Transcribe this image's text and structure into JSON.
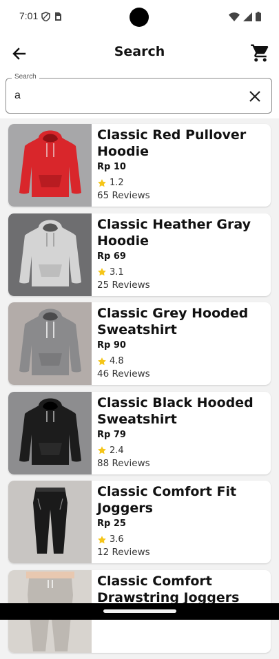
{
  "status": {
    "time": "7:01",
    "icons": [
      "shield-icon",
      "sim-card-icon",
      "wifi-icon",
      "signal-icon",
      "battery-icon"
    ]
  },
  "app_bar": {
    "title": "Search",
    "back_icon": "arrow-back-icon",
    "cart_icon": "shopping-cart-icon"
  },
  "search": {
    "label": "Search",
    "value": "a",
    "clear_icon": "close-icon"
  },
  "products": [
    {
      "name": "Classic Red Pullover Hoodie",
      "price": "Rp 10",
      "rating": "1.2",
      "reviews": "65 Reviews",
      "image": "red-hoodie",
      "color": "#d9262b"
    },
    {
      "name": "Classic Heather Gray Hoodie",
      "price": "Rp 69",
      "rating": "3.1",
      "reviews": "25 Reviews",
      "image": "heather-gray-hoodie",
      "color": "#c9c9c9"
    },
    {
      "name": "Classic Grey Hooded Sweatshirt",
      "price": "Rp 90",
      "rating": "4.8",
      "reviews": "46 Reviews",
      "image": "grey-hooded-sweatshirt",
      "color": "#8a8a8c"
    },
    {
      "name": "Classic Black Hooded Sweatshirt",
      "price": "Rp 79",
      "rating": "2.4",
      "reviews": "88 Reviews",
      "image": "black-hooded-sweatshirt",
      "color": "#1c1c1c"
    },
    {
      "name": "Classic Comfort Fit Joggers",
      "price": "Rp 25",
      "rating": "3.6",
      "reviews": "12 Reviews",
      "image": "black-joggers",
      "color": "#1a1a1a"
    },
    {
      "name": "Classic Comfort Drawstring Joggers",
      "price": "",
      "rating": "",
      "reviews": "",
      "image": "gray-drawstring-joggers",
      "color": "#bdb8b2"
    }
  ],
  "colors": {
    "star": "#f5c518",
    "card_bg": "#ffffff",
    "page_bg": "#f2f2f2"
  }
}
